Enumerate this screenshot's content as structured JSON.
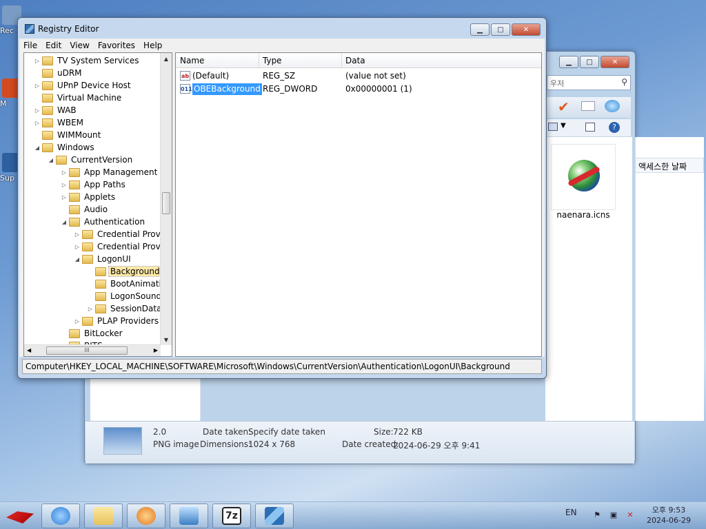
{
  "desktop": {
    "icons": [
      {
        "label": "Rec",
        "color": "#7a9cc4"
      },
      {
        "label": "M",
        "color": "#d34b1e"
      },
      {
        "label": "Sup",
        "color": "#2e5f9e"
      }
    ]
  },
  "explorer": {
    "search_placeholder": "우저",
    "column_header": "액세스한 날짜",
    "thumbnail_label": "naenara.icns",
    "details": {
      "version": "2.0",
      "type": "PNG image",
      "date_taken_label": "Date taken:",
      "date_taken_value": "Specify date taken",
      "dimensions_label": "Dimensions:",
      "dimensions_value": "1024 x 768",
      "size_label": "Size:",
      "size_value": "722 KB",
      "date_created_label": "Date created:",
      "date_created_value": "2024-06-29 오후 9:41"
    }
  },
  "regedit": {
    "title": "Registry Editor",
    "menu": [
      "File",
      "Edit",
      "View",
      "Favorites",
      "Help"
    ],
    "tree": [
      {
        "label": "TV System Services",
        "level": 1,
        "expander": "▷"
      },
      {
        "label": "uDRM",
        "level": 1,
        "expander": ""
      },
      {
        "label": "UPnP Device Host",
        "level": 1,
        "expander": "▷"
      },
      {
        "label": "Virtual Machine",
        "level": 1,
        "expander": ""
      },
      {
        "label": "WAB",
        "level": 1,
        "expander": "▷"
      },
      {
        "label": "WBEM",
        "level": 1,
        "expander": "▷"
      },
      {
        "label": "WIMMount",
        "level": 1,
        "expander": ""
      },
      {
        "label": "Windows",
        "level": 1,
        "expander": "◢"
      },
      {
        "label": "CurrentVersion",
        "level": 2,
        "expander": "◢"
      },
      {
        "label": "App Management",
        "level": 3,
        "expander": "▷"
      },
      {
        "label": "App Paths",
        "level": 3,
        "expander": "▷"
      },
      {
        "label": "Applets",
        "level": 3,
        "expander": "▷"
      },
      {
        "label": "Audio",
        "level": 3,
        "expander": ""
      },
      {
        "label": "Authentication",
        "level": 3,
        "expander": "◢"
      },
      {
        "label": "Credential Provid",
        "level": 4,
        "expander": "▷"
      },
      {
        "label": "Credential Provid",
        "level": 4,
        "expander": "▷"
      },
      {
        "label": "LogonUI",
        "level": 4,
        "expander": "◢"
      },
      {
        "label": "Background",
        "level": 5,
        "expander": "",
        "selected": true
      },
      {
        "label": "BootAnimati",
        "level": 5,
        "expander": ""
      },
      {
        "label": "LogonSound",
        "level": 5,
        "expander": ""
      },
      {
        "label": "SessionData",
        "level": 5,
        "expander": "▷"
      },
      {
        "label": "PLAP Providers",
        "level": 4,
        "expander": "▷"
      },
      {
        "label": "BitLocker",
        "level": 3,
        "expander": ""
      },
      {
        "label": "BITS",
        "level": 3,
        "expander": ""
      }
    ],
    "columns": {
      "name": "Name",
      "type": "Type",
      "data": "Data"
    },
    "values": [
      {
        "icon": "ab",
        "name": "(Default)",
        "type": "REG_SZ",
        "data": "(value not set)"
      },
      {
        "icon": "011",
        "name": "OBEBackground",
        "type": "REG_DWORD",
        "data": "0x00000001 (1)",
        "selected": true
      }
    ],
    "scroll_thumb_glyph": "III",
    "status_path": "Computer\\HKEY_LOCAL_MACHINE\\SOFTWARE\\Microsoft\\Windows\\CurrentVersion\\Authentication\\LogonUI\\Background"
  },
  "taskbar": {
    "apps": [
      {
        "name": "internet-explorer",
        "color": "#2f7fd8"
      },
      {
        "name": "windows-explorer",
        "color": "#e8c35a"
      },
      {
        "name": "media-player",
        "color": "#e07a20"
      },
      {
        "name": "remote-desktop",
        "color": "#3b7ec4"
      },
      {
        "name": "7zip",
        "label": "7z",
        "color": "#222222"
      },
      {
        "name": "registry-editor",
        "color": "#3f88c8"
      }
    ],
    "language": "EN",
    "clock_time": "오후 9:53",
    "clock_date": "2024-06-29"
  }
}
